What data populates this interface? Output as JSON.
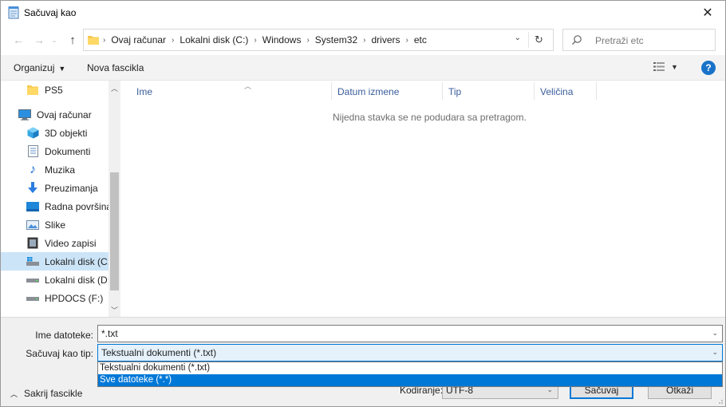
{
  "window": {
    "title": "Sačuvaj kao"
  },
  "address": {
    "crumbs": [
      "Ovaj računar",
      "Lokalni disk (C:)",
      "Windows",
      "System32",
      "drivers",
      "etc"
    ],
    "search_placeholder": "Pretraži etc"
  },
  "toolbar": {
    "organize_label": "Organizuj",
    "new_folder_label": "Nova fascikla"
  },
  "nav": {
    "items": [
      {
        "label": "PS5",
        "icon": "folder-icon"
      },
      {
        "label": "Ovaj računar",
        "icon": "computer-icon"
      },
      {
        "label": "3D objekti",
        "icon": "cube-icon"
      },
      {
        "label": "Dokumenti",
        "icon": "document-icon"
      },
      {
        "label": "Muzika",
        "icon": "music-icon"
      },
      {
        "label": "Preuzimanja",
        "icon": "download-icon"
      },
      {
        "label": "Radna površina",
        "icon": "desktop-icon"
      },
      {
        "label": "Slike",
        "icon": "pictures-icon"
      },
      {
        "label": "Video zapisi",
        "icon": "video-icon"
      },
      {
        "label": "Lokalni disk (C:)",
        "icon": "drive-icon"
      },
      {
        "label": "Lokalni disk (D:)",
        "icon": "drive-icon"
      },
      {
        "label": "HPDOCS (F:)",
        "icon": "drive-icon"
      }
    ],
    "selected_index": 9
  },
  "columns": [
    "Ime",
    "Datum izmene",
    "Tip",
    "Veličina"
  ],
  "empty_message": "Nijedna stavka se ne podudara sa pretragom.",
  "form": {
    "filename_label": "Ime datoteke:",
    "filename_value": "*.txt",
    "type_label": "Sačuvaj kao tip:",
    "type_value": "Tekstualni dokumenti (*.txt)",
    "type_options": [
      "Tekstualni dokumenti (*.txt)",
      "Sve datoteke  (*.*)"
    ],
    "type_highlighted_index": 1,
    "encoding_label": "Kodiranje:",
    "encoding_value": "UTF-8",
    "save_label": "Sačuvaj",
    "cancel_label": "Otkaži",
    "hide_folders_label": "Sakrij fascikle"
  },
  "colors": {
    "accent": "#0078d7",
    "selection": "#cce4f7",
    "help": "#1a73c9"
  }
}
